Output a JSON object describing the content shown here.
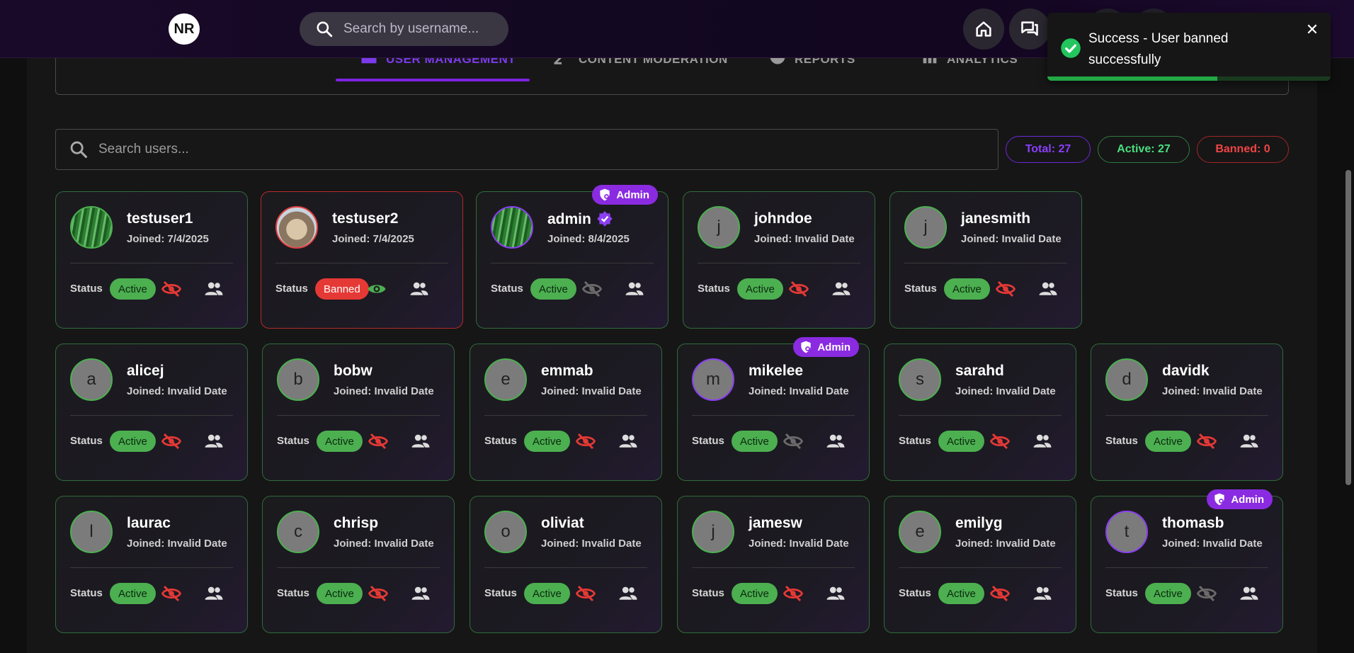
{
  "navbar": {
    "logo_text": "NR",
    "search_placeholder": "Search by username..."
  },
  "tabs": [
    {
      "label": "USER MANAGEMENT",
      "icon": "user-list-icon",
      "active": true
    },
    {
      "label": "CONTENT MODERATION",
      "icon": "moderation-icon",
      "active": false
    },
    {
      "label": "REPORTS",
      "icon": "report-icon",
      "active": false
    },
    {
      "label": "ANALYTICS",
      "icon": "bar-chart-icon",
      "active": false
    }
  ],
  "user_search": {
    "placeholder": "Search users..."
  },
  "stats": {
    "total": "Total: 27",
    "active": "Active: 27",
    "banned": "Banned: 0"
  },
  "status_label": "Status",
  "admin_label": "Admin",
  "users": [
    {
      "username": "testuser1",
      "joined": "Joined: 7/4/2025",
      "status": "Active",
      "initial": "",
      "avatar": "green-image",
      "admin": false,
      "verified": false,
      "eye": "hidden"
    },
    {
      "username": "testuser2",
      "joined": "Joined: 7/4/2025",
      "status": "Banned",
      "initial": "",
      "avatar": "dog-image",
      "admin": false,
      "verified": false,
      "eye": "visible"
    },
    {
      "username": "admin",
      "joined": "Joined: 8/4/2025",
      "status": "Active",
      "initial": "",
      "avatar": "green-image",
      "admin": true,
      "verified": true,
      "eye": "disabled"
    },
    {
      "username": "johndoe",
      "joined": "Joined: Invalid Date",
      "status": "Active",
      "initial": "j",
      "avatar": "",
      "admin": false,
      "verified": false,
      "eye": "hidden"
    },
    {
      "username": "janesmith",
      "joined": "Joined: Invalid Date",
      "status": "Active",
      "initial": "j",
      "avatar": "",
      "admin": false,
      "verified": false,
      "eye": "hidden"
    },
    {
      "username": "alicej",
      "joined": "Joined: Invalid Date",
      "status": "Active",
      "initial": "a",
      "avatar": "",
      "admin": false,
      "verified": false,
      "eye": "hidden"
    },
    {
      "username": "bobw",
      "joined": "Joined: Invalid Date",
      "status": "Active",
      "initial": "b",
      "avatar": "",
      "admin": false,
      "verified": false,
      "eye": "hidden"
    },
    {
      "username": "emmab",
      "joined": "Joined: Invalid Date",
      "status": "Active",
      "initial": "e",
      "avatar": "",
      "admin": false,
      "verified": false,
      "eye": "hidden"
    },
    {
      "username": "mikelee",
      "joined": "Joined: Invalid Date",
      "status": "Active",
      "initial": "m",
      "avatar": "",
      "admin": true,
      "verified": false,
      "eye": "disabled"
    },
    {
      "username": "sarahd",
      "joined": "Joined: Invalid Date",
      "status": "Active",
      "initial": "s",
      "avatar": "",
      "admin": false,
      "verified": false,
      "eye": "hidden"
    },
    {
      "username": "davidk",
      "joined": "Joined: Invalid Date",
      "status": "Active",
      "initial": "d",
      "avatar": "",
      "admin": false,
      "verified": false,
      "eye": "hidden"
    },
    {
      "username": "laurac",
      "joined": "Joined: Invalid Date",
      "status": "Active",
      "initial": "l",
      "avatar": "",
      "admin": false,
      "verified": false,
      "eye": "hidden"
    },
    {
      "username": "chrisp",
      "joined": "Joined: Invalid Date",
      "status": "Active",
      "initial": "c",
      "avatar": "",
      "admin": false,
      "verified": false,
      "eye": "hidden"
    },
    {
      "username": "oliviat",
      "joined": "Joined: Invalid Date",
      "status": "Active",
      "initial": "o",
      "avatar": "",
      "admin": false,
      "verified": false,
      "eye": "hidden"
    },
    {
      "username": "jamesw",
      "joined": "Joined: Invalid Date",
      "status": "Active",
      "initial": "j",
      "avatar": "",
      "admin": false,
      "verified": false,
      "eye": "hidden"
    },
    {
      "username": "emilyg",
      "joined": "Joined: Invalid Date",
      "status": "Active",
      "initial": "e",
      "avatar": "",
      "admin": false,
      "verified": false,
      "eye": "hidden"
    },
    {
      "username": "thomasb",
      "joined": "Joined: Invalid Date",
      "status": "Active",
      "initial": "t",
      "avatar": "",
      "admin": true,
      "verified": false,
      "eye": "disabled"
    }
  ],
  "toast": {
    "message": "Success - User banned successfully",
    "progress": 0.6,
    "icon": "check-circle-icon"
  },
  "colors": {
    "accent": "#7c3aed",
    "active": "#4caf50",
    "banned": "#e53935",
    "admin": "#8a2be2"
  }
}
